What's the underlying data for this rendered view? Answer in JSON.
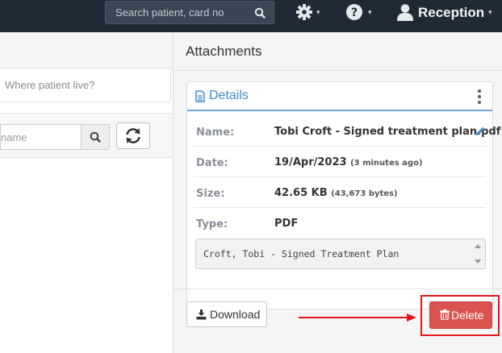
{
  "header": {
    "search": {
      "placeholder": "Search patient, card no",
      "icon": "search-icon"
    },
    "settings_icon": "gear-icon",
    "help_icon": "question-circle-icon",
    "user": {
      "label": "Reception",
      "icon": "user-icon"
    },
    "colors": {
      "bar": "#1f2a36"
    }
  },
  "left_panel": {
    "question_placeholder": "Where patient live?",
    "name_search_placeholder": "name",
    "search_icon": "search-icon",
    "refresh_icon": "refresh-icon"
  },
  "attachments": {
    "title": "Attachments",
    "details": {
      "title": "Details",
      "fields": [
        {
          "label": "Name:",
          "value": "Tobi Croft - Signed treatment plan.pdf",
          "note": ""
        },
        {
          "label": "Date:",
          "value": "19/Apr/2023",
          "note": "(3 minutes ago)"
        },
        {
          "label": "Size:",
          "value": "42.65 KB",
          "note": "(43,673 bytes)"
        },
        {
          "label": "Type:",
          "value": "PDF",
          "note": ""
        }
      ],
      "description": "Croft, Tobi - Signed Treatment Plan"
    },
    "download_label": "Download",
    "delete_label": "Delete",
    "colors": {
      "accent": "#3c8dce",
      "danger": "#d9534f",
      "highlight": "#e01818"
    }
  }
}
